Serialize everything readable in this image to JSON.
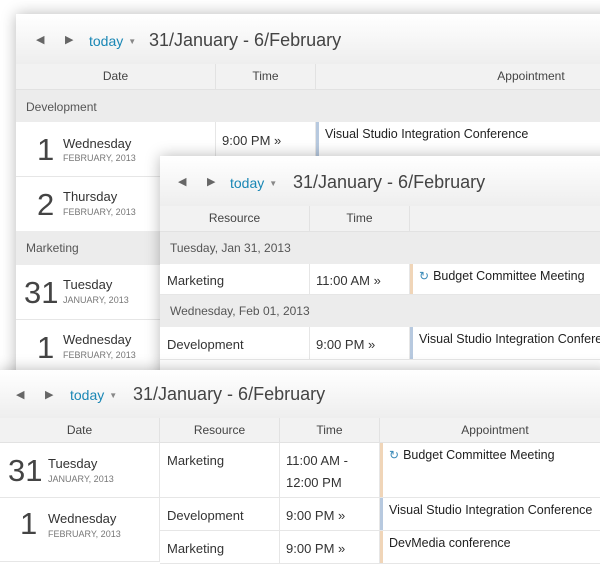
{
  "toolbar": {
    "prev_icon": "chevron-left-icon",
    "next_icon": "chevron-right-icon",
    "today_label": "today",
    "range_label": "31/January - 6/February"
  },
  "view1": {
    "columns": [
      "Date",
      "Time",
      "Appointment"
    ],
    "groups": [
      {
        "name": "Development",
        "rows": [
          {
            "day": "1",
            "weekday": "Wednesday",
            "sub": "FEBRUARY, 2013",
            "time": "9:00 PM »",
            "appointment": "Visual Studio Integration Conference"
          },
          {
            "day": "2",
            "weekday": "Thursday",
            "sub": "FEBRUARY, 2013",
            "time": "",
            "appointment": ""
          }
        ]
      },
      {
        "name": "Marketing",
        "rows": [
          {
            "day": "31",
            "weekday": "Tuesday",
            "sub": "JANUARY, 2013",
            "time": "",
            "appointment": ""
          },
          {
            "day": "1",
            "weekday": "Wednesday",
            "sub": "FEBRUARY, 2013",
            "time": "",
            "appointment": ""
          }
        ]
      }
    ]
  },
  "view2": {
    "columns": [
      "Resource",
      "Time",
      ""
    ],
    "groups": [
      {
        "date": "Tuesday, Jan 31, 2013",
        "rows": [
          {
            "resource": "Marketing",
            "time": "11:00 AM »",
            "appointment": "Budget Committee Meeting",
            "recurring": true
          }
        ]
      },
      {
        "date": "Wednesday, Feb 01, 2013",
        "rows": [
          {
            "resource": "Development",
            "time": "9:00 PM »",
            "appointment": "Visual Studio Integration Conference",
            "recurring": false
          }
        ]
      }
    ]
  },
  "view3": {
    "columns": [
      "Date",
      "Resource",
      "Time",
      "Appointment"
    ],
    "days": [
      {
        "day": "31",
        "weekday": "Tuesday",
        "sub": "JANUARY, 2013",
        "rows": [
          {
            "resource": "Marketing",
            "time_line1": "11:00 AM -",
            "time_line2": "12:00 PM",
            "appointment": "Budget Committee Meeting",
            "recurring": true
          }
        ]
      },
      {
        "day": "1",
        "weekday": "Wednesday",
        "sub": "FEBRUARY, 2013",
        "rows": [
          {
            "resource": "Development",
            "time_line1": "9:00 PM »",
            "time_line2": "",
            "appointment": "Visual Studio Integration Conference",
            "recurring": false
          },
          {
            "resource": "Marketing",
            "time_line1": "9:00 PM »",
            "time_line2": "",
            "appointment": "DevMedia conference",
            "recurring": false
          }
        ]
      }
    ]
  },
  "colors": {
    "accent": "#1a87b5",
    "appointment_blue": "#b7c9df",
    "appointment_orange": "#f0d5b8",
    "group_bg": "#ececec"
  }
}
